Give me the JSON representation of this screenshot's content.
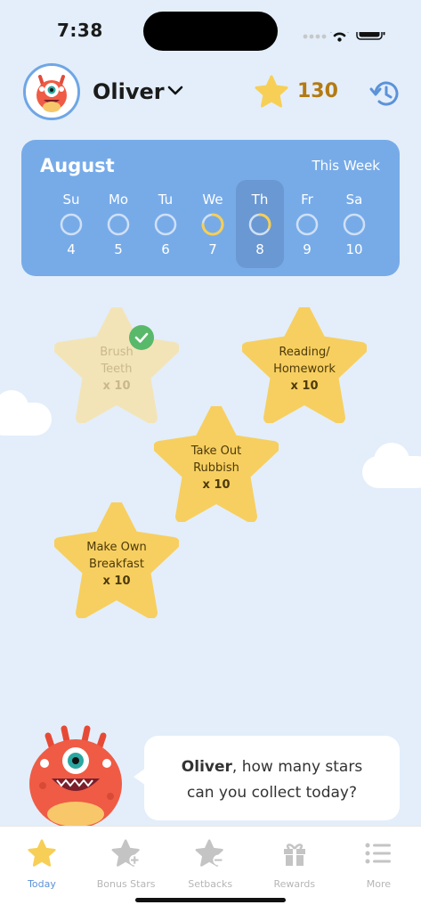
{
  "status": {
    "time": "7:38"
  },
  "header": {
    "name": "Oliver",
    "star_count": "130"
  },
  "week": {
    "month": "August",
    "range_label": "This Week",
    "days": [
      {
        "name": "Su",
        "num": "4",
        "progress": 0
      },
      {
        "name": "Mo",
        "num": "5",
        "progress": 0
      },
      {
        "name": "Tu",
        "num": "6",
        "progress": 0
      },
      {
        "name": "We",
        "num": "7",
        "progress": 0.75
      },
      {
        "name": "Th",
        "num": "8",
        "progress": 0.3,
        "selected": true
      },
      {
        "name": "Fr",
        "num": "9",
        "progress": 0
      },
      {
        "name": "Sa",
        "num": "10",
        "progress": 0
      }
    ]
  },
  "chores": [
    {
      "line1": "Brush",
      "line2": "Teeth",
      "qty": "x 10",
      "done": true
    },
    {
      "line1": "Reading/",
      "line2": "Homework",
      "qty": "x 10",
      "done": false
    },
    {
      "line1": "Take Out",
      "line2": "Rubbish",
      "qty": "x 10",
      "done": false
    },
    {
      "line1": "Make Own",
      "line2": "Breakfast",
      "qty": "x 10",
      "done": false
    }
  ],
  "bubble": {
    "name": "Oliver",
    "line1_rest": ", how many stars",
    "line2": "can you collect today?"
  },
  "tabs": [
    {
      "label": "Today",
      "icon": "star-icon",
      "active": true
    },
    {
      "label": "Bonus Stars",
      "icon": "bonus-star-icon",
      "active": false
    },
    {
      "label": "Setbacks",
      "icon": "setback-star-icon",
      "active": false
    },
    {
      "label": "Rewards",
      "icon": "gift-icon",
      "active": false
    },
    {
      "label": "More",
      "icon": "menu-list-icon",
      "active": false
    }
  ],
  "colors": {
    "accent": "#5b92d9",
    "calendar": "#77abe8",
    "star": "#f7cf60",
    "star_text": "#b47a12",
    "done_check": "#58b96a"
  }
}
